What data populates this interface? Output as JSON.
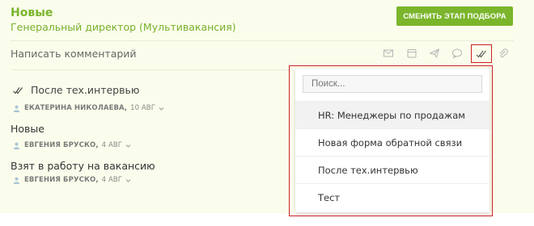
{
  "header": {
    "status": "Новые",
    "vacancy": "Генеральный директор (Мультивакансия)",
    "change_stage_button": "СМЕНИТЬ ЭТАП ПОДБОРА"
  },
  "comment": {
    "placeholder": "Написать комментарий",
    "toolbar_icons": [
      "mail-icon",
      "calendar-icon",
      "send-icon",
      "chat-icon",
      "double-check-icon",
      "paperclip-icon"
    ]
  },
  "activity": {
    "items": [
      {
        "title": "После тех.интервью",
        "user": "ЕКАТЕРИНА НИКОЛАЕВА,",
        "date": "10 АВГ"
      },
      {
        "title": "Новые",
        "user": "ЕВГЕНИЯ БРУСКО,",
        "date": "4 АВГ"
      },
      {
        "title": "Взят в работу на вакансию",
        "user": "ЕВГЕНИЯ БРУСКО,",
        "date": "4 АВГ"
      }
    ]
  },
  "dropdown": {
    "search_placeholder": "Поиск...",
    "options": [
      "HR: Менеджеры по продажам",
      "Новая форма обратной связи",
      "После тех.интервью",
      "Тест"
    ]
  },
  "colors": {
    "accent": "#7ab52b",
    "card_background": "#fbfdec",
    "highlight": "#cc2222"
  }
}
